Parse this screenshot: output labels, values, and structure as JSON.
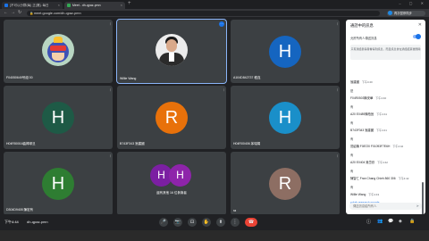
{
  "browser": {
    "tabs": [
      {
        "label": "[不可以分群(每) 正(第]- 每日",
        "fav_color": "#1a73e8"
      },
      {
        "label": "Meet - dh-qpaz-pmn",
        "fav_color": "#34a853"
      }
    ],
    "new_tab": "+",
    "window_controls": "– ▢ ✕",
    "url": "meet.google.com/dh-qpaz-pmn",
    "profile": "再次暂停同步",
    "nav": {
      "back": "←",
      "forward": "→",
      "reload": "↻"
    }
  },
  "tiles": [
    {
      "name": "F04050649号组 00",
      "type": "cartoon"
    },
    {
      "name": "Willie Wang",
      "type": "photo",
      "active": true
    },
    {
      "name": "A104D842737 嵇连",
      "initial": "H",
      "color": "#1565c0"
    },
    {
      "name": "H04R50016曲棒球旦",
      "initial": "H",
      "color": "#1e5a46"
    },
    {
      "name": "B743F343 翁建國",
      "initial": "R",
      "color": "#e8710a"
    },
    {
      "name": "H04R00406 茅瑞娟",
      "initial": "H",
      "color": "#1a8fc9"
    },
    {
      "name": "D304D9405 陳宏有",
      "initial": "H",
      "color": "#2e7d32"
    },
    {
      "name": "",
      "group_label": "還有其他 16 位參與者",
      "avatars": [
        {
          "initial": "H",
          "color": "#7b1fa2"
        },
        {
          "initial": "H",
          "color": "#8e24aa"
        }
      ]
    },
    {
      "name": "ra",
      "initial": "R",
      "color": "#8d6e63"
    }
  ],
  "chat": {
    "title": "通話中的訊息",
    "close": "✕",
    "toggle_label": "允許所有人傳送訊息",
    "notice": "只有通話參與者看得到訊息，而且訊息會在通話結束後刪除",
    "messages": [
      {
        "sender": "翁建國",
        "time": "下午4:40",
        "text": "是"
      },
      {
        "sender": "F04R0503陳安華",
        "time": "下午4:40",
        "text": "有"
      },
      {
        "sender": "A20 E0489陳柏藝",
        "time": "下午4:41",
        "text": "有"
      },
      {
        "sender": "B743F343 翁建國",
        "time": "下午4:41",
        "text": "有"
      },
      {
        "sender": "范紹楠 F08720 F01093F7E6H",
        "time": "下午4:42",
        "text": "有"
      },
      {
        "sender": "A20 E0404 吳岱欣",
        "time": "下午4:42",
        "text": "有"
      },
      {
        "sender": "陳智仁 Fran Chang Chieh 860 306",
        "time": "下午4:42",
        "text": "有"
      },
      {
        "sender": "Willie Wang",
        "time": "下午4:43",
        "text": "colab.research.google"
      }
    ],
    "input_placeholder": "傳送訊息給所有人",
    "send": "➤"
  },
  "bottom": {
    "time": "下午4:44",
    "code": "dh-qpaz-pmn",
    "controls": [
      "🎤",
      "📷",
      "⊡",
      "✋",
      "⬆",
      "⋮"
    ],
    "end": "☎",
    "right_icons": [
      "ⓘ",
      "👥",
      "💬",
      "◈",
      "🔒"
    ]
  }
}
